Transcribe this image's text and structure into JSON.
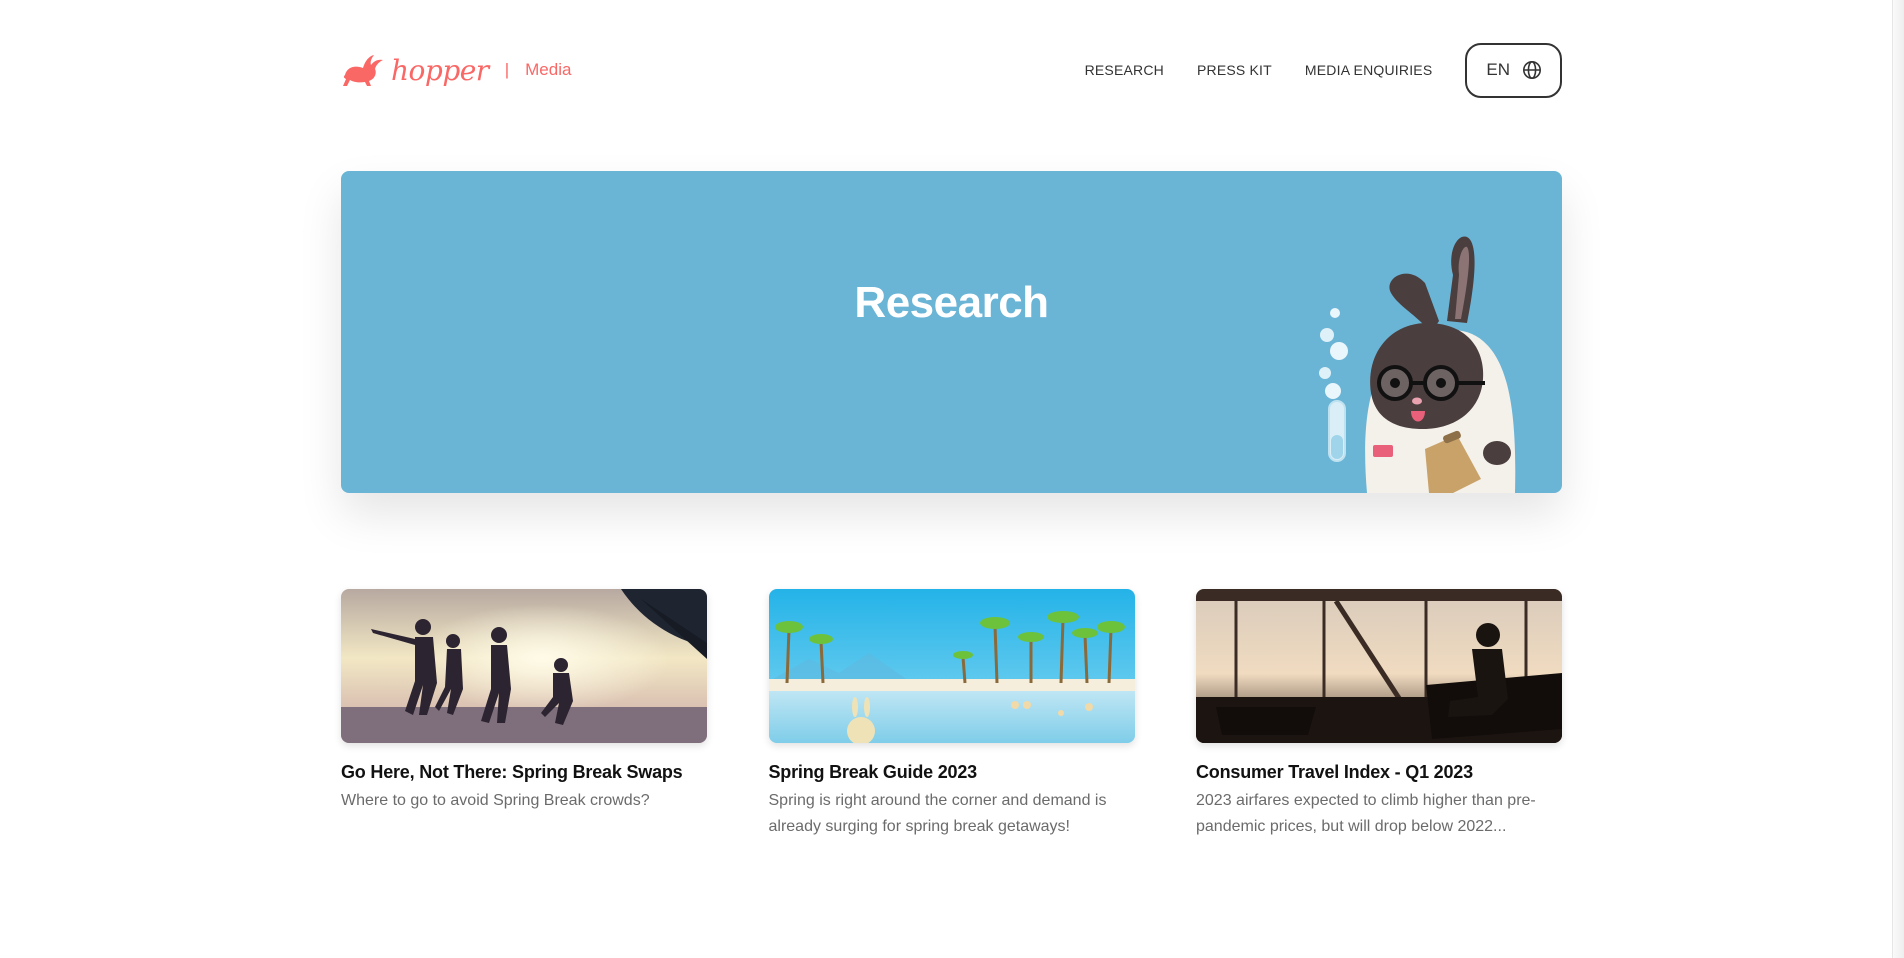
{
  "brand": {
    "name": "hopper",
    "separator": "|",
    "section": "Media",
    "color": "#fa6866"
  },
  "nav": {
    "items": [
      {
        "label": "RESEARCH"
      },
      {
        "label": "PRESS KIT"
      },
      {
        "label": "MEDIA ENQUIRIES"
      }
    ],
    "language": {
      "label": "EN",
      "icon": "globe-icon"
    }
  },
  "hero": {
    "title": "Research",
    "background": "#6ab4d6",
    "illustration": "bunny-scientist-illustration"
  },
  "cards": [
    {
      "title": "Go Here, Not There: Spring Break Swaps",
      "description": "Where to go to avoid Spring Break crowds?",
      "image": "friends-jumping-beach-photo"
    },
    {
      "title": "Spring Break Guide 2023",
      "description": "Spring is right around the corner and demand is already surging for spring break getaways!",
      "image": "palm-beach-illustration"
    },
    {
      "title": "Consumer Travel Index - Q1 2023",
      "description": "2023 airfares expected to climb higher than pre-pandemic prices, but will drop below 2022...",
      "image": "airport-lounge-silhouette-photo"
    }
  ]
}
